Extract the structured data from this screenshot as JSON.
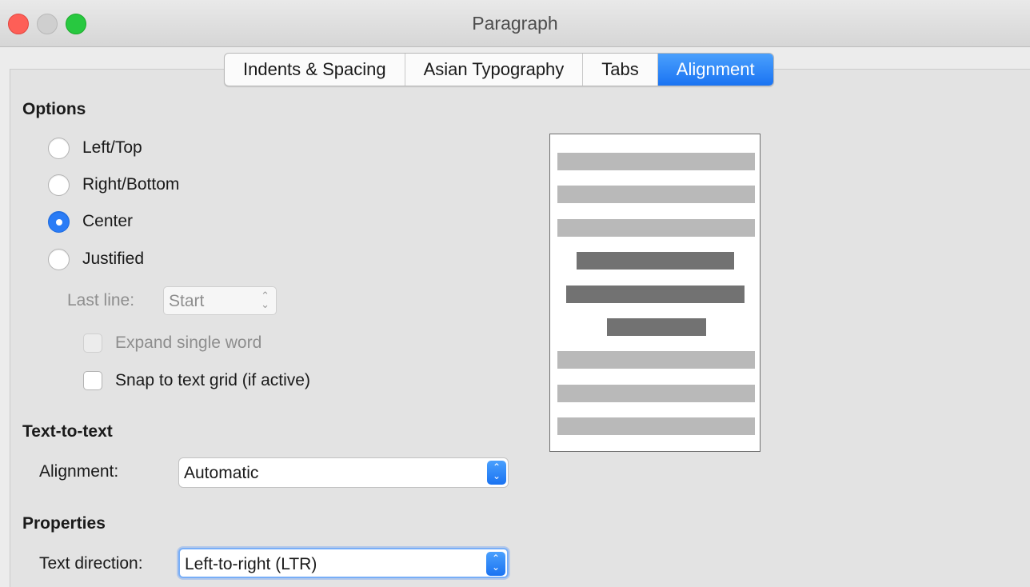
{
  "window": {
    "title": "Paragraph"
  },
  "tabs": [
    "Indents & Spacing",
    "Asian Typography",
    "Tabs",
    "Alignment"
  ],
  "active_tab": "Alignment",
  "options": {
    "heading": "Options",
    "radios": [
      {
        "label": "Left/Top",
        "checked": false
      },
      {
        "label": "Right/Bottom",
        "checked": false
      },
      {
        "label": "Center",
        "checked": true
      },
      {
        "label": "Justified",
        "checked": false
      }
    ],
    "last_line": {
      "label": "Last line:",
      "value": "Start",
      "disabled": true
    },
    "expand_single_word": {
      "label": "Expand single word",
      "checked": false,
      "disabled": true
    },
    "snap_to_grid": {
      "label": "Snap to text grid (if active)",
      "checked": false
    }
  },
  "text_to_text": {
    "heading": "Text-to-text",
    "alignment_label": "Alignment:",
    "alignment_value": "Automatic"
  },
  "properties": {
    "heading": "Properties",
    "direction_label": "Text direction:",
    "direction_value": "Left-to-right (LTR)"
  },
  "colors": {
    "accent": "#1a73f2",
    "preview_line_light": "#b9b9b9",
    "preview_line_dark": "#727272"
  }
}
